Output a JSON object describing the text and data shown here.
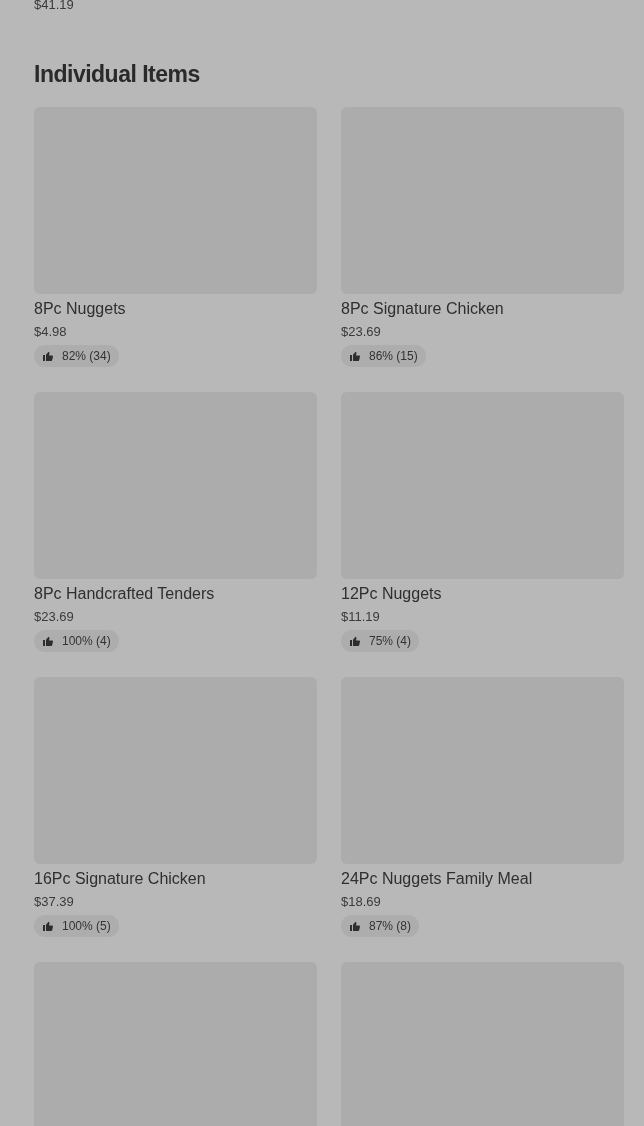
{
  "previous_section": {
    "price": "$41.19"
  },
  "section": {
    "title": "Individual Items"
  },
  "items": [
    {
      "kind": "product",
      "name": "8Pc Nuggets",
      "price": "$4.98",
      "rating": "82% (34)"
    },
    {
      "kind": "product",
      "name": "8Pc Signature Chicken",
      "price": "$23.69",
      "rating": "86% (15)"
    },
    {
      "kind": "product",
      "name": "8Pc Handcrafted Tenders",
      "price": "$23.69",
      "rating": "100% (4)"
    },
    {
      "kind": "product",
      "name": "12Pc Nuggets",
      "price": "$11.19",
      "rating": "75% (4)"
    },
    {
      "kind": "product",
      "name": "16Pc Signature Chicken",
      "price": "$37.39",
      "rating": "100% (5)"
    },
    {
      "kind": "product",
      "name": "24Pc Nuggets Family Meal",
      "price": "$18.69",
      "rating": "87% (8)"
    },
    {
      "kind": "image_only"
    },
    {
      "kind": "image_only"
    }
  ]
}
